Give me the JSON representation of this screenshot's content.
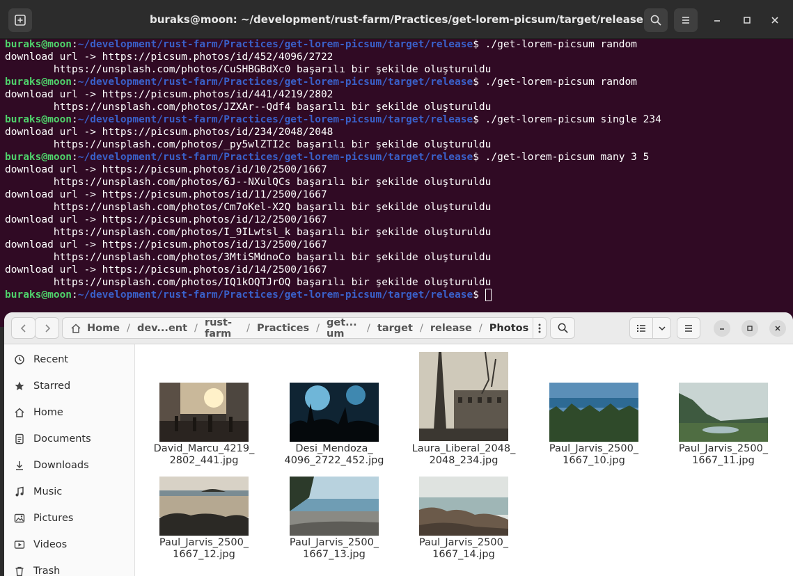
{
  "terminal": {
    "title": "buraks@moon: ~/development/rust-farm/Practices/get-lorem-picsum/target/release",
    "prompt_user": "buraks@moon",
    "prompt_path": "~/development/rust-farm/Practices/get-lorem-picsum/target/release",
    "lines": [
      {
        "kind": "prompt",
        "cmd": " ./get-lorem-picsum random"
      },
      {
        "kind": "out",
        "text": "download url -> https://picsum.photos/id/452/4096/2722"
      },
      {
        "kind": "out",
        "text": "        https://unsplash.com/photos/CuSHBGBdXc0 başarılı bir şekilde oluşturuldu"
      },
      {
        "kind": "prompt",
        "cmd": " ./get-lorem-picsum random"
      },
      {
        "kind": "out",
        "text": "download url -> https://picsum.photos/id/441/4219/2802"
      },
      {
        "kind": "out",
        "text": "        https://unsplash.com/photos/JZXAr--Qdf4 başarılı bir şekilde oluşturuldu"
      },
      {
        "kind": "prompt",
        "cmd": " ./get-lorem-picsum single 234"
      },
      {
        "kind": "out",
        "text": "download url -> https://picsum.photos/id/234/2048/2048"
      },
      {
        "kind": "out",
        "text": "        https://unsplash.com/photos/_py5wlZTI2c başarılı bir şekilde oluşturuldu"
      },
      {
        "kind": "prompt",
        "cmd": " ./get-lorem-picsum many 3 5"
      },
      {
        "kind": "out",
        "text": "download url -> https://picsum.photos/id/10/2500/1667"
      },
      {
        "kind": "out",
        "text": "        https://unsplash.com/photos/6J--NXulQCs başarılı bir şekilde oluşturuldu"
      },
      {
        "kind": "out",
        "text": "download url -> https://picsum.photos/id/11/2500/1667"
      },
      {
        "kind": "out",
        "text": "        https://unsplash.com/photos/Cm7oKel-X2Q başarılı bir şekilde oluşturuldu"
      },
      {
        "kind": "out",
        "text": "download url -> https://picsum.photos/id/12/2500/1667"
      },
      {
        "kind": "out",
        "text": "        https://unsplash.com/photos/I_9ILwtsl_k başarılı bir şekilde oluşturuldu"
      },
      {
        "kind": "out",
        "text": "download url -> https://picsum.photos/id/13/2500/1667"
      },
      {
        "kind": "out",
        "text": "        https://unsplash.com/photos/3MtiSMdnoCo başarılı bir şekilde oluşturuldu"
      },
      {
        "kind": "out",
        "text": "download url -> https://picsum.photos/id/14/2500/1667"
      },
      {
        "kind": "out",
        "text": "        https://unsplash.com/photos/IQ1kOQTJrOQ başarılı bir şekilde oluşturuldu"
      },
      {
        "kind": "prompt",
        "cmd": " "
      }
    ]
  },
  "files": {
    "path": [
      "Home",
      "dev...ent",
      "rust-farm",
      "Practices",
      "get... um",
      "target",
      "release",
      "Photos"
    ],
    "sidebar": [
      {
        "label": "Recent",
        "icon": "clock-icon"
      },
      {
        "label": "Starred",
        "icon": "star-icon"
      },
      {
        "label": "Home",
        "icon": "home-icon"
      },
      {
        "label": "Documents",
        "icon": "document-icon"
      },
      {
        "label": "Downloads",
        "icon": "download-icon"
      },
      {
        "label": "Music",
        "icon": "music-icon"
      },
      {
        "label": "Pictures",
        "icon": "picture-icon"
      },
      {
        "label": "Videos",
        "icon": "video-icon"
      },
      {
        "label": "Trash",
        "icon": "trash-icon"
      }
    ],
    "items": [
      {
        "name": "David_Marcu_4219_\n2802_441.jpg",
        "scene": "city street, warm sunlight"
      },
      {
        "name": "Desi_Mendoza_\n4096_2722_452.jpg",
        "scene": "concert crowd, blue light"
      },
      {
        "name": "Laura_Liberal_2048_\n2048_234.jpg",
        "scene": "Eiffel tower, sepia"
      },
      {
        "name": "Paul_Jarvis_2500_\n1667_10.jpg",
        "scene": "sea over forest"
      },
      {
        "name": "Paul_Jarvis_2500_\n1667_11.jpg",
        "scene": "misty valley, river"
      },
      {
        "name": "Paul_Jarvis_2500_\n1667_12.jpg",
        "scene": "beach with dark rocks"
      },
      {
        "name": "Paul_Jarvis_2500_\n1667_13.jpg",
        "scene": "pebble beach, trees"
      },
      {
        "name": "Paul_Jarvis_2500_\n1667_14.jpg",
        "scene": "rocky coast, sea"
      }
    ]
  }
}
